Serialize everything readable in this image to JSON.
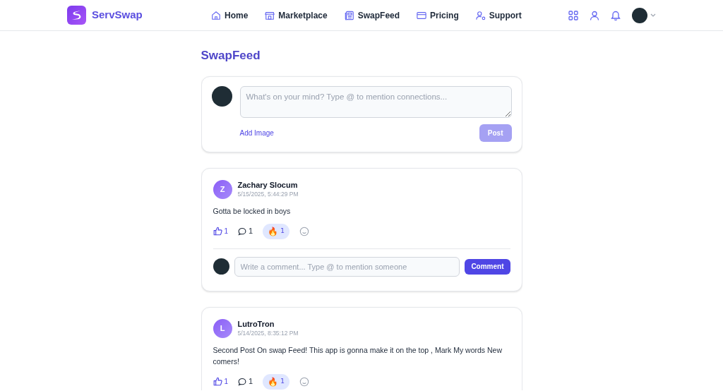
{
  "brand": {
    "name": "ServSwap"
  },
  "nav": [
    {
      "label": "Home",
      "kind": "home"
    },
    {
      "label": "Marketplace",
      "kind": "store"
    },
    {
      "label": "SwapFeed",
      "kind": "feed"
    },
    {
      "label": "Pricing",
      "kind": "card"
    },
    {
      "label": "Support",
      "kind": "support"
    }
  ],
  "page_title": "SwapFeed",
  "composer": {
    "placeholder": "What's on your mind? Type @ to mention connections...",
    "add_image": "Add Image",
    "post_button": "Post",
    "post_disabled": true
  },
  "posts": [
    {
      "initial": "Z",
      "author": "Zachary Slocum",
      "time": "5/15/2025, 5:44:29 PM",
      "text": "Gotta be locked in boys",
      "likes": "1",
      "liked": true,
      "comments": "1",
      "reactions": [
        {
          "emoji": "🔥",
          "count": "1",
          "selected": true
        }
      ],
      "comment_box": {
        "placeholder": "Write a comment... Type @ to mention someone",
        "button": "Comment"
      }
    },
    {
      "initial": "L",
      "author": "LutroTron",
      "time": "5/14/2025, 8:35:12 PM",
      "text": "Second Post On swap Feed! This app is gonna make it on the top , Mark My words New comers!",
      "likes": "1",
      "liked": true,
      "comments": "1",
      "reactions": [
        {
          "emoji": "🔥",
          "count": "1",
          "selected": true
        }
      ]
    }
  ]
}
